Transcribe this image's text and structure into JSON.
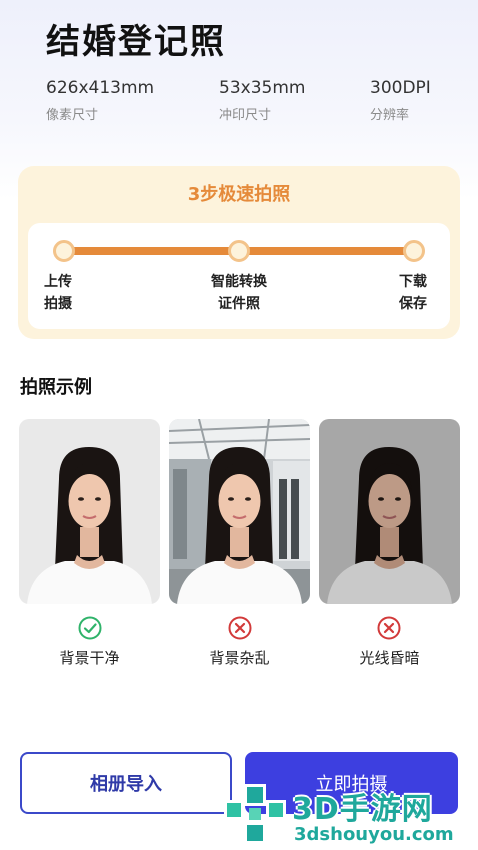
{
  "header": {
    "title": "结婚登记照",
    "specs": [
      {
        "value": "626x413mm",
        "label": "像素尺寸"
      },
      {
        "value": "53x35mm",
        "label": "冲印尺寸"
      },
      {
        "value": "300DPI",
        "label": "分辨率"
      }
    ]
  },
  "steps": {
    "title": "3步极速拍照",
    "items": [
      {
        "line1": "上传",
        "line2": "拍摄"
      },
      {
        "line1": "智能转换",
        "line2": "证件照"
      },
      {
        "line1": "下载",
        "line2": "保存"
      }
    ]
  },
  "examples": {
    "section_title": "拍照示例",
    "items": [
      {
        "label": "背景干净",
        "status": "correct",
        "icon": "check-circle-icon"
      },
      {
        "label": "背景杂乱",
        "status": "wrong",
        "icon": "cross-circle-icon"
      },
      {
        "label": "光线昏暗",
        "status": "wrong",
        "icon": "cross-circle-icon"
      }
    ]
  },
  "actions": {
    "album_label": "相册导入",
    "shoot_label": "立即拍摄"
  },
  "watermark": {
    "name": "3D手游网",
    "url": "3dshouyou.com"
  },
  "colors": {
    "accent": "#e58a3a",
    "primary": "#3d3fe0",
    "correct": "#2fb36a",
    "wrong": "#d23a3a",
    "watermark": "#1fa89c"
  }
}
